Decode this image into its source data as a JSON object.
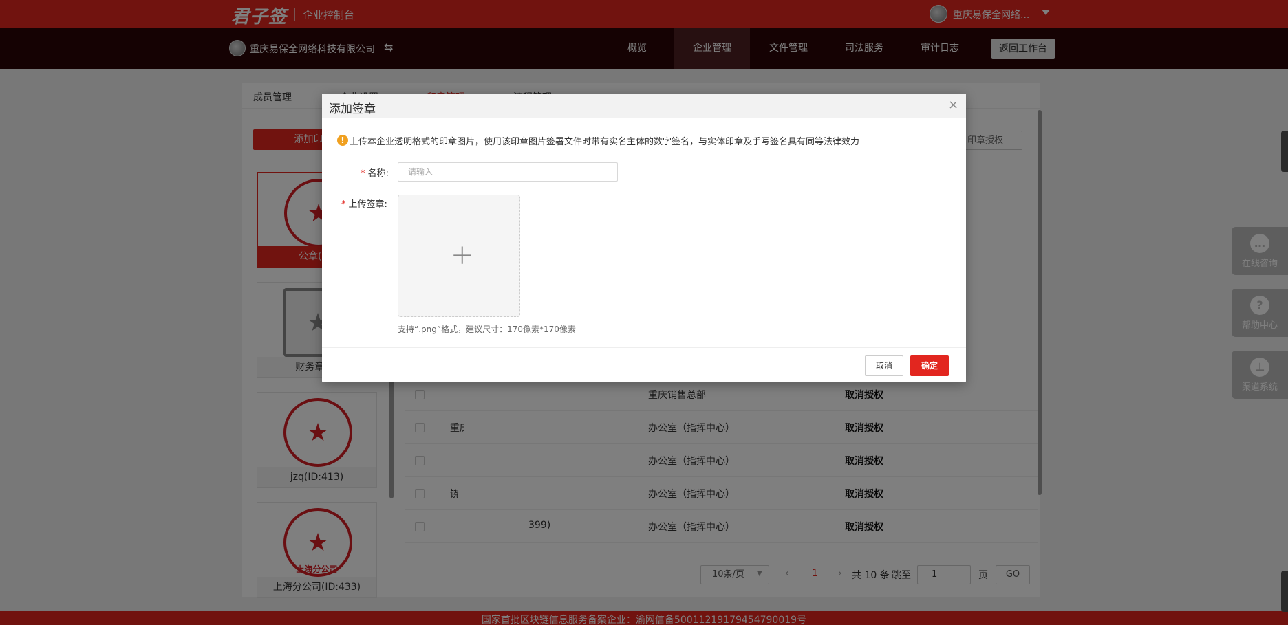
{
  "topbar": {
    "logo": "君子签",
    "console_title": "企业控制台",
    "user_name": "重庆易保全网络..."
  },
  "navbar": {
    "company_name": "重庆易保全网络科技有限公司",
    "switch_icon": "switch-arrows-icon",
    "items": [
      {
        "label": "概览"
      },
      {
        "label": "企业管理",
        "active": true
      },
      {
        "label": "文件管理"
      },
      {
        "label": "司法服务"
      },
      {
        "label": "审计日志"
      }
    ],
    "back_label": "返回工作台"
  },
  "tabs": [
    {
      "label": "成员管理"
    },
    {
      "label": "企业设置"
    },
    {
      "label": "印章管理"
    },
    {
      "label": "流程管理"
    }
  ],
  "left_panel": {
    "add_label": "添加印章",
    "seals": [
      {
        "label": "公章(ID:"
      },
      {
        "label": "财务章(ID"
      },
      {
        "label": "jzq(ID:413)"
      },
      {
        "label": "上海分公司(ID:433)",
        "sub": "上海分公司"
      }
    ]
  },
  "table": {
    "auth_button": "印章授权",
    "rows": [
      {
        "prefix": "",
        "suffix": "",
        "dept": "重庆销售总部",
        "action": "取消授权"
      },
      {
        "prefix": "重庆",
        "suffix": "",
        "dept": "办公室（指挥中心）",
        "action": "取消授权"
      },
      {
        "prefix": "",
        "suffix": "",
        "dept": "办公室（指挥中心）",
        "action": "取消授权"
      },
      {
        "prefix": "饶",
        "suffix": "",
        "dept": "办公室（指挥中心）",
        "action": "取消授权"
      },
      {
        "prefix": "",
        "suffix": "399)",
        "dept": "办公室（指挥中心）",
        "action": "取消授权"
      }
    ]
  },
  "pagination": {
    "page_size": "10条/页",
    "current": "1",
    "total": "共 10 条",
    "jump": "跳至",
    "input": "1",
    "page": "页",
    "go": "GO"
  },
  "footer": {
    "text": "国家首批区块链信息服务备案企业：渝网信备50011219179454790019号"
  },
  "floats": [
    {
      "label": "在线咨询",
      "icon": "chat-icon"
    },
    {
      "label": "帮助中心",
      "icon": "help-icon"
    },
    {
      "label": "渠道系统",
      "icon": "org-icon"
    }
  ],
  "modal": {
    "title": "添加签章",
    "notice": "上传本企业透明格式的印章图片，使用该印章图片签署文件时带有实名主体的数字签名，与实体印章及手写签名具有同等法律效力",
    "name_label": "名称:",
    "name_placeholder": "请输入",
    "name_value": "",
    "upload_label": "上传签章:",
    "upload_hint": "支持“.png”格式，建议尺寸：170像素*170像素",
    "cancel": "取消",
    "ok": "确定"
  },
  "colors": {
    "brand_red": "#e2261f",
    "nav_dark": "#2b0507"
  }
}
